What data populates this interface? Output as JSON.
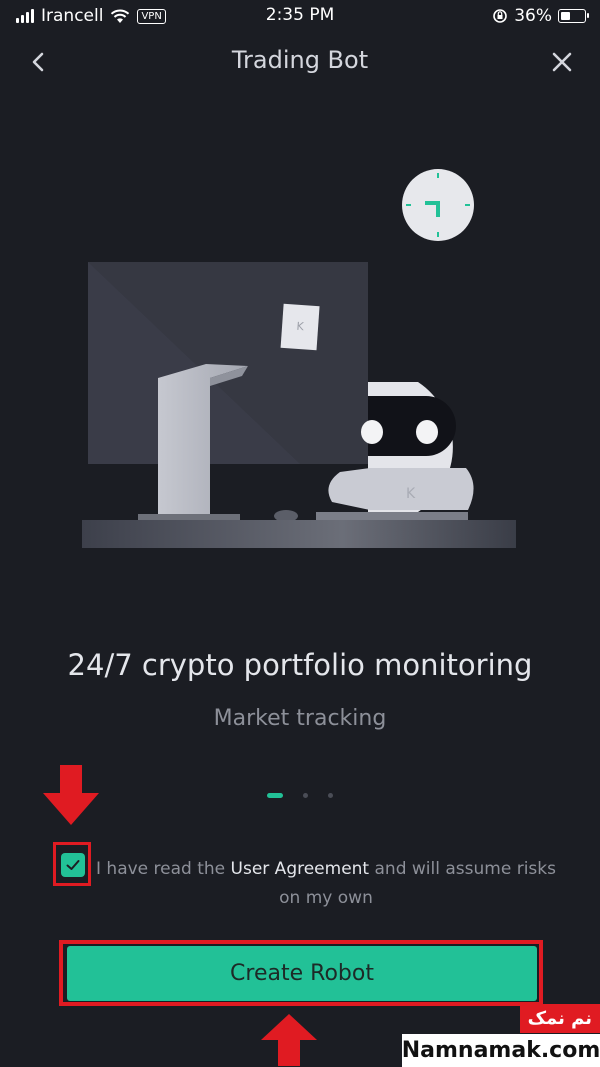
{
  "status_bar": {
    "carrier": "Irancell",
    "vpn": "VPN",
    "time": "2:35 PM",
    "battery": "36%"
  },
  "nav": {
    "title": "Trading Bot"
  },
  "feature": {
    "headline": "24/7 crypto portfolio monitoring",
    "subhead": "Market tracking",
    "page_indicator": {
      "total": 3,
      "active": 1
    }
  },
  "agreement": {
    "checked": true,
    "text_before": "I have read the ",
    "link": "User Agreement",
    "text_after": " and will assume risks on my own"
  },
  "create_button": {
    "label": "Create Robot"
  },
  "watermark": {
    "farsi": "نم نمک",
    "site": "Namnamak.com"
  },
  "colors": {
    "background": "#1b1d23",
    "accent": "#22c197",
    "annotation_red": "#e01b22"
  },
  "icons": [
    "signal-icon",
    "wifi-icon",
    "back-icon",
    "close-icon",
    "check-icon",
    "orientation-lock-icon",
    "battery-icon",
    "arrow-down-icon",
    "arrow-up-icon"
  ]
}
